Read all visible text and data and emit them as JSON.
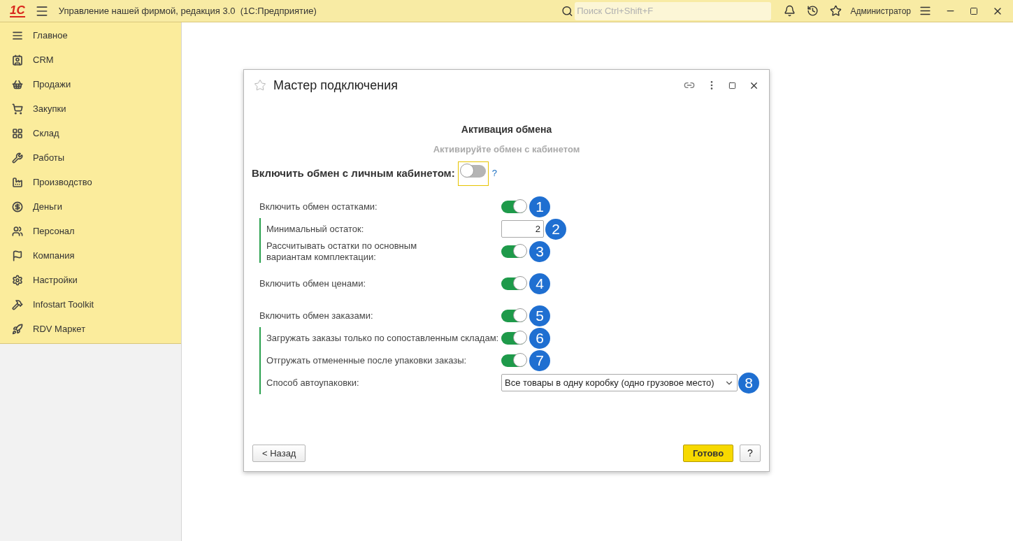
{
  "app_bar": {
    "logo": "1С",
    "title": "Управление нашей фирмой, редакция 3.0  (1С:Предприятие)",
    "search": {
      "placeholder": "Поиск Ctrl+Shift+F"
    },
    "user": "Администратор"
  },
  "sidebar": {
    "items": [
      {
        "label": "Главное",
        "kind": "list"
      },
      {
        "label": "CRM",
        "kind": "card"
      },
      {
        "label": "Продажи",
        "kind": "basket"
      },
      {
        "label": "Закупки",
        "kind": "cart"
      },
      {
        "label": "Склад",
        "kind": "grid"
      },
      {
        "label": "Работы",
        "kind": "tools"
      },
      {
        "label": "Производство",
        "kind": "factory"
      },
      {
        "label": "Деньги",
        "kind": "ruble"
      },
      {
        "label": "Персонал",
        "kind": "people"
      },
      {
        "label": "Компания",
        "kind": "flag"
      },
      {
        "label": "Настройки",
        "kind": "gear"
      },
      {
        "label": "Infostart Toolkit",
        "kind": "wrench"
      },
      {
        "label": "RDV Маркет",
        "kind": "rocket"
      }
    ]
  },
  "dialog": {
    "title": "Мастер подключения",
    "heading": "Активация обмена",
    "subheading": "Активируйте обмен с кабинетом",
    "master_switch": {
      "label": "Включить обмен с личным кабинетом:",
      "on": false,
      "help": "?"
    },
    "sections": [
      {
        "row": {
          "kind": "toggle",
          "label": "Включить обмен остатками:",
          "on": true,
          "badge": "1"
        },
        "children": [
          {
            "kind": "number",
            "label": "Минимальный остаток:",
            "value": "2",
            "badge": "2"
          },
          {
            "kind": "toggle",
            "label": "Рассчитывать остатки по основным\nвариантам комплектации:",
            "on": true,
            "badge": "3"
          }
        ]
      },
      {
        "row": {
          "kind": "toggle",
          "label": "Включить обмен ценами:",
          "on": true,
          "badge": "4"
        }
      },
      {
        "row": {
          "kind": "toggle",
          "label": "Включить обмен заказами:",
          "on": true,
          "badge": "5"
        },
        "children": [
          {
            "kind": "toggle",
            "label": "Загружать заказы только по сопоставленным складам:",
            "on": true,
            "badge": "6"
          },
          {
            "kind": "toggle",
            "label": "Отгружать отмененные после упаковки заказы:",
            "on": true,
            "badge": "7"
          },
          {
            "kind": "select",
            "label": "Способ автоупаковки:",
            "value": "Все товары в одну коробку (одно грузовое место)",
            "badge": "8"
          }
        ]
      }
    ],
    "buttons": {
      "back": "< Назад",
      "done": "Готово",
      "help": "?"
    }
  }
}
